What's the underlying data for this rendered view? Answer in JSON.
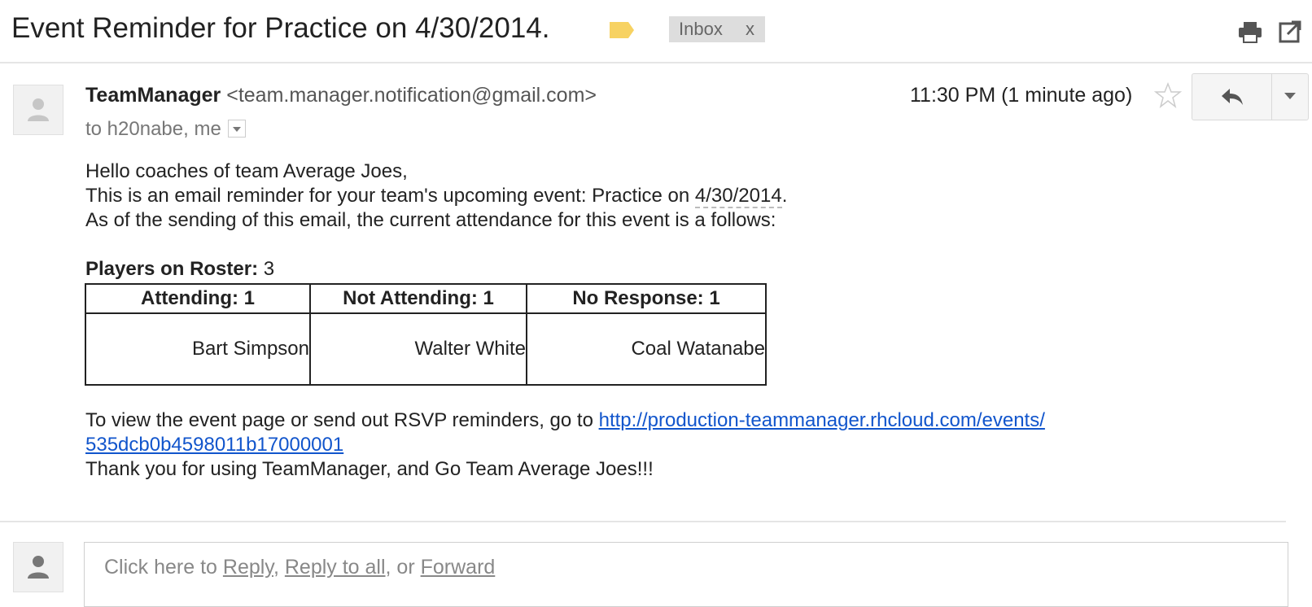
{
  "header": {
    "subject": "Event Reminder for Practice on 4/30/2014.",
    "label_chip": "Inbox",
    "label_chip_close": "x",
    "label_color": "#f7d262",
    "print_icon": "print-icon",
    "new_window_icon": "new-window-icon"
  },
  "message": {
    "sender_name": "TeamManager",
    "sender_email": "<team.manager.notification@gmail.com>",
    "recipients": "to h20nabe, me",
    "timestamp": "11:30 PM (1 minute ago)",
    "star_icon": "star-icon",
    "reply_icon": "reply-icon",
    "more_icon": "chevron-down-icon"
  },
  "body": {
    "greeting": "Hello coaches of team Average Joes,",
    "reminder_prefix": "This is an email reminder for your team's upcoming event: Practice on ",
    "reminder_date": "4/30/2014",
    "reminder_suffix": ".",
    "attendance_intro": "As of the sending of this email, the current attendance for this event is a follows:",
    "roster_label": "Players on Roster:",
    "roster_count": "3",
    "table": {
      "headers": [
        "Attending: 1",
        "Not Attending: 1",
        "No Response: 1"
      ],
      "cells": [
        "Bart Simpson",
        "Walter White",
        "Coal Watanabe"
      ]
    },
    "view_prefix": "To view the event page or send out RSVP reminders, go to ",
    "link_part1": "http://production-teammanager.rhcloud.com/events/",
    "link_part2": "535dcb0b4598011b17000001",
    "thanks": "Thank you for using TeamManager, and Go Team Average Joes!!!"
  },
  "reply_box": {
    "prefix": "Click here to ",
    "reply": "Reply",
    "sep1": ", ",
    "reply_all": "Reply to all",
    "sep2": ", or ",
    "forward": "Forward"
  },
  "colors": {
    "link": "#1155cc",
    "chip_bg": "#dddddd"
  }
}
